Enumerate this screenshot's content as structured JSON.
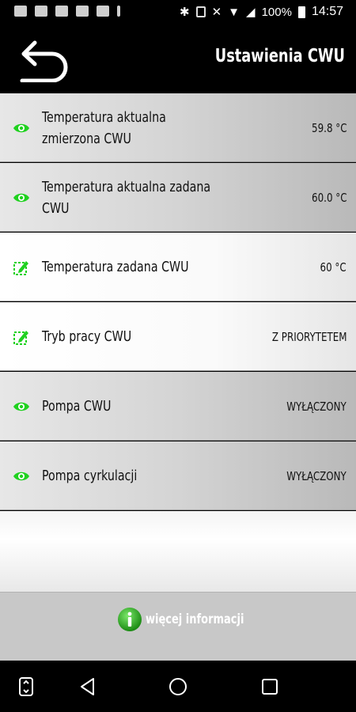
{
  "status_bar": {
    "battery": "100%",
    "time": "14:57"
  },
  "header": {
    "title": "Ustawienia CWU",
    "back_icon": "back-arrow-icon"
  },
  "rows": [
    {
      "label": "Temperatura aktualna zmierzona CWU",
      "value": "59.8 °C",
      "icon": "eye-icon"
    },
    {
      "label": "Temperatura aktualna zadana CWU",
      "value": "60.0 °C",
      "icon": "eye-icon"
    },
    {
      "label": "Temperatura zadana CWU",
      "value": "60 °C",
      "icon": "edit-icon"
    },
    {
      "label": "Tryb pracy CWU",
      "value": "Z PRIORYTETEM",
      "icon": "edit-icon"
    },
    {
      "label": "Pompa CWU",
      "value": "WYŁĄCZONY",
      "icon": "eye-icon"
    },
    {
      "label": "Pompa cyrkulacji",
      "value": "WYŁĄCZONY",
      "icon": "eye-icon"
    }
  ],
  "more_info": {
    "label": "więcej informacji",
    "icon": "info-icon"
  },
  "colors": {
    "accent_green": "#1fd11f",
    "header_bg": "#000000"
  }
}
